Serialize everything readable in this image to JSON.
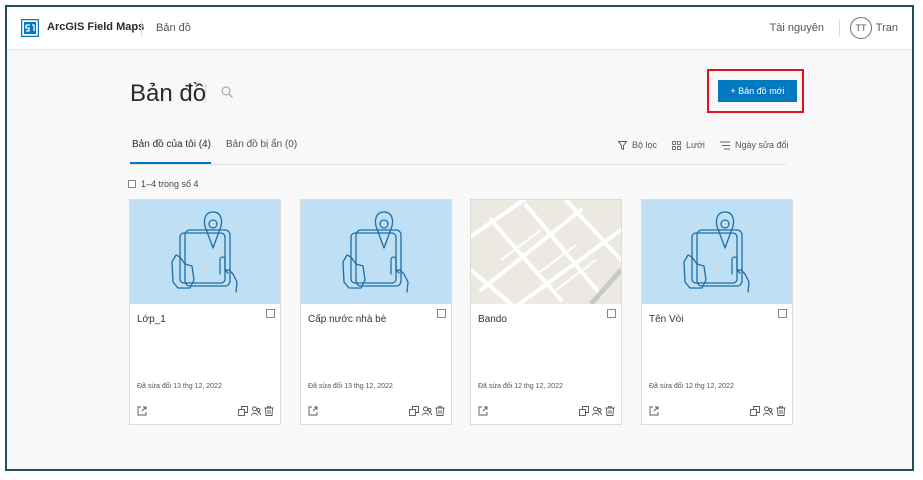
{
  "header": {
    "app_name": "ArcGIS Field Maps",
    "breadcrumb": "Bản đồ",
    "resources_label": "Tài nguyên",
    "avatar_initials": "TT",
    "username": "Tran"
  },
  "page": {
    "title": "Bản đồ",
    "new_map_label": "+  Bản đồ mới"
  },
  "tabs": [
    {
      "label": "Bản đồ của tôi (4)",
      "active": true
    },
    {
      "label": "Bản đồ bị ẩn (0)",
      "active": false
    }
  ],
  "toolbar": {
    "filter_label": "Bộ lọc",
    "grid_label": "Lưới",
    "sort_label": "Ngày sửa đổi"
  },
  "results": {
    "count_label": "1–4 trong số 4"
  },
  "cards": [
    {
      "title": "Lớp_1",
      "modified": "Đã sửa đổi 13 thg 12, 2022",
      "thumbnail": "tablet-hand-icon"
    },
    {
      "title": "Cấp nước nhà bè",
      "modified": "Đã sửa đổi 13 thg 12, 2022",
      "thumbnail": "tablet-hand-icon"
    },
    {
      "title": "Bando",
      "modified": "Đã sửa đổi 12 thg 12, 2022",
      "thumbnail": "street-map"
    },
    {
      "title": "Tên Vòi",
      "modified": "Đã sửa đổi 12 thg 12, 2022",
      "thumbnail": "tablet-hand-icon"
    }
  ],
  "colors": {
    "accent": "#0079c1",
    "highlight_border": "#e0121b",
    "thumbnail_bg": "#bfdff4",
    "frame_border": "#1f4f5b"
  }
}
